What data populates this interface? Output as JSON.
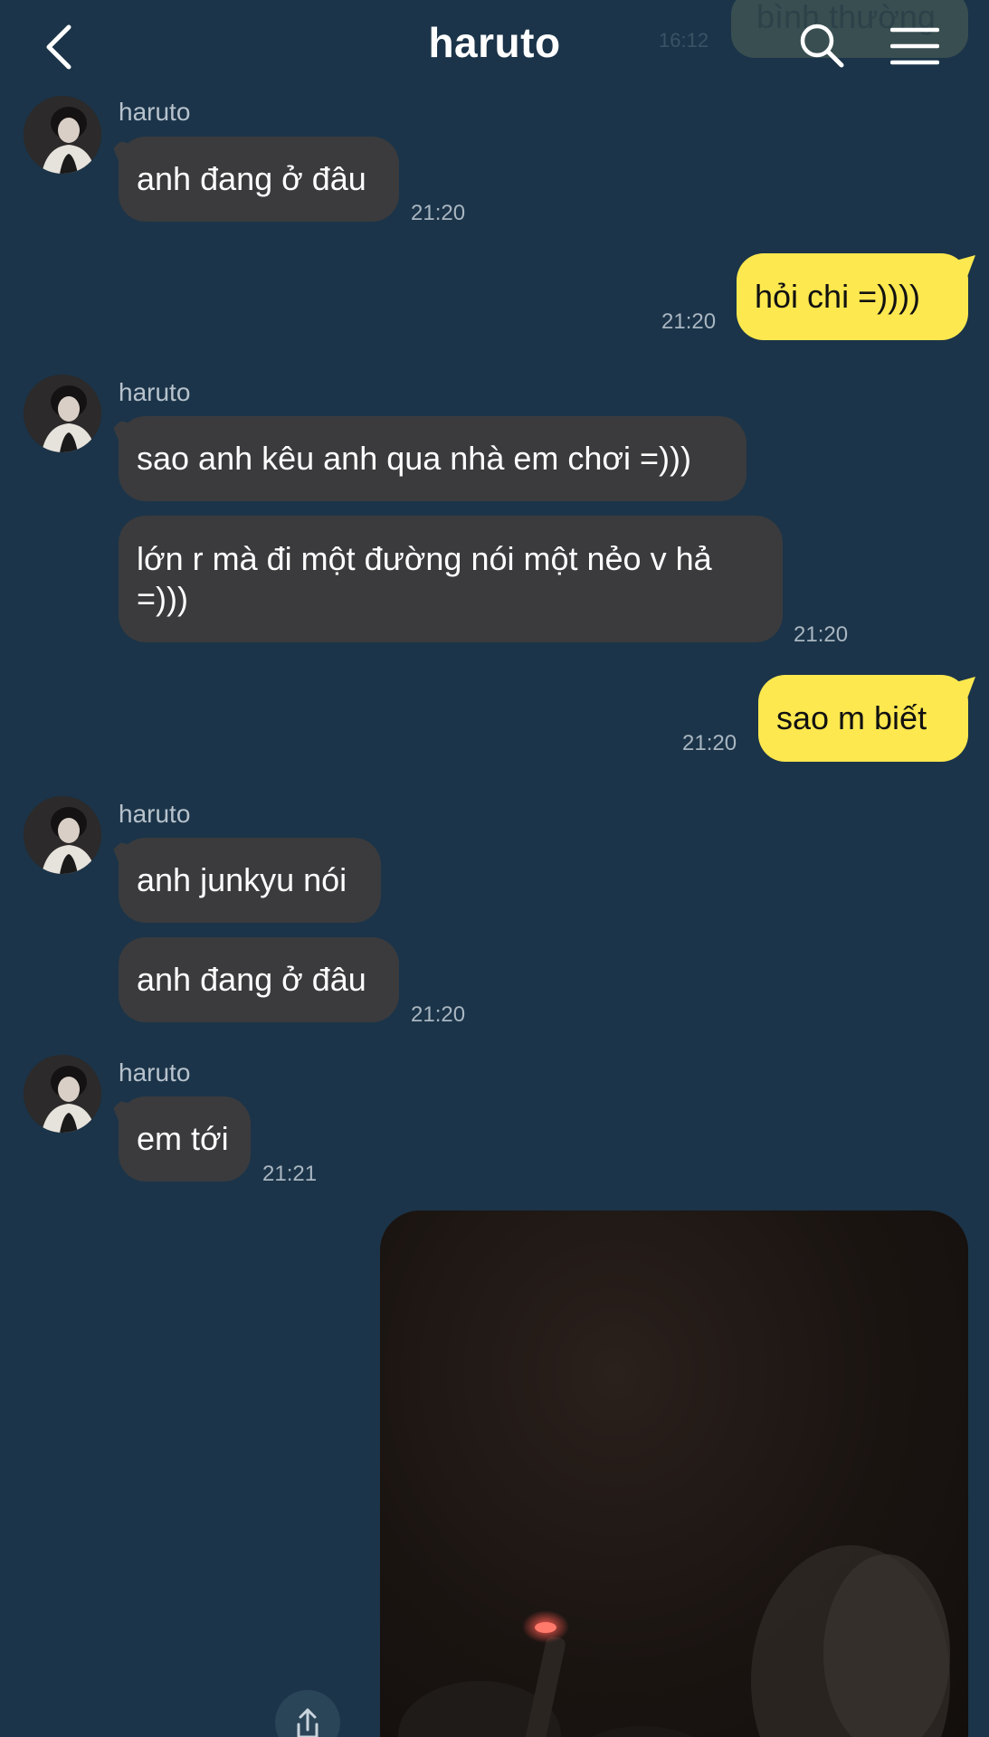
{
  "header": {
    "title": "haruto",
    "ghost_message": "bình thường",
    "ghost_time": "16:12"
  },
  "messages": [
    {
      "sender": "haruto",
      "bubbles": [
        "anh đang ở đâu"
      ],
      "time": "21:20"
    },
    {
      "outgoing": "hỏi chi =))))",
      "time": "21:20"
    },
    {
      "sender": "haruto",
      "bubbles": [
        "sao anh kêu anh qua nhà em chơi =)))",
        "lớn r mà đi một đường nói một nẻo v hả =)))"
      ],
      "time": "21:20"
    },
    {
      "outgoing": "sao m biết",
      "time": "21:20"
    },
    {
      "sender": "haruto",
      "bubbles": [
        "anh junkyu nói",
        "anh đang ở đâu"
      ],
      "time": "21:20"
    },
    {
      "sender": "haruto",
      "bubbles": [
        "em tới"
      ],
      "time": "21:21"
    }
  ],
  "icons": {
    "back": "chevron-left-icon",
    "search": "search-icon",
    "menu": "hamburger-menu-icon",
    "share": "share-icon"
  },
  "colors": {
    "background": "#1b3449",
    "incoming_bubble": "#3b3b3d",
    "outgoing_bubble": "#fde84f"
  }
}
